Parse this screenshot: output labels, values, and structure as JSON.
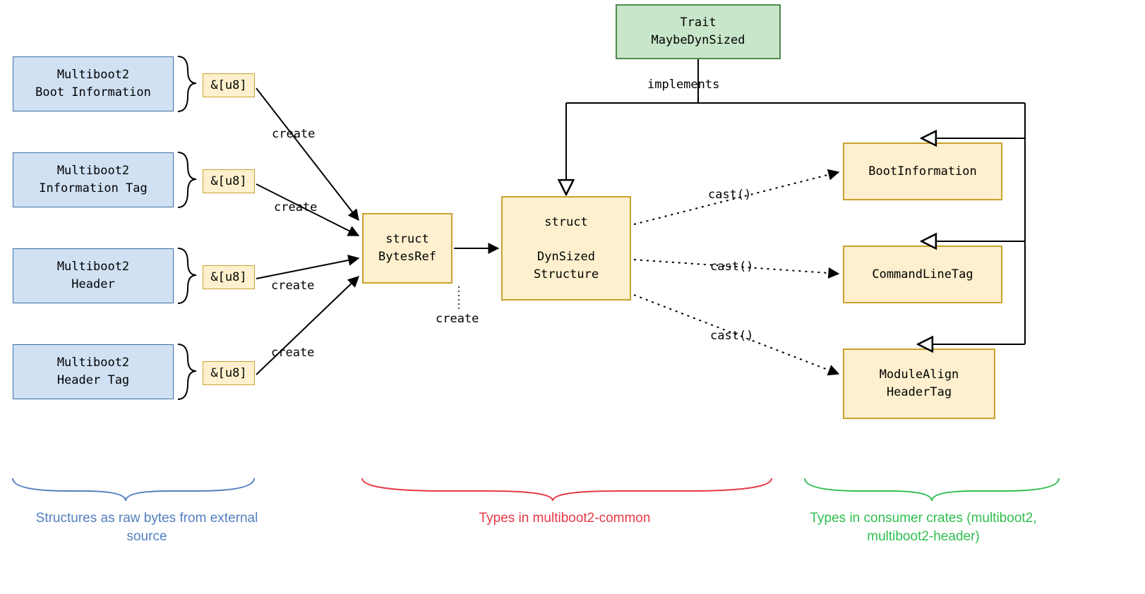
{
  "source_boxes": [
    {
      "name": "multiboot2-boot-information",
      "text": "Multiboot2\nBoot Information"
    },
    {
      "name": "multiboot2-information-tag",
      "text": "Multiboot2\nInformation Tag"
    },
    {
      "name": "multiboot2-header",
      "text": "Multiboot2\nHeader"
    },
    {
      "name": "multiboot2-header-tag",
      "text": "Multiboot2\nHeader Tag"
    }
  ],
  "slice_label": "&[u8]",
  "create_label": "create",
  "bytesref": {
    "text": "struct\nBytesRef"
  },
  "dynstruct": {
    "text": "struct\n\nDynSized\nStructure"
  },
  "trait_box": {
    "text": "Trait\nMaybeDynSized"
  },
  "implements_label": "implements",
  "cast_label": "cast()",
  "consumer_types": [
    {
      "name": "bootinformation",
      "text": "BootInformation"
    },
    {
      "name": "commandlinetag",
      "text": "CommandLineTag"
    },
    {
      "name": "modulealign-headertag",
      "text": "ModuleAlign\nHeaderTag"
    }
  ],
  "captions": {
    "blue": "Structures as raw bytes from\nexternal source",
    "red": "Types in multiboot2-common",
    "green": "Types in consumer crates\n(multiboot2, multiboot2-header)"
  },
  "colors": {
    "blue_fill": "#D0E1F4",
    "blue_border": "#3A6FA7",
    "yellow_fill": "#FEF0CE",
    "yellow_border": "#CAA12F",
    "green_fill": "#C8E6C9",
    "green_border": "#4E8A4E",
    "caption_blue": "#527FBF",
    "caption_red": "#E63946",
    "caption_green": "#2FBF4E"
  }
}
